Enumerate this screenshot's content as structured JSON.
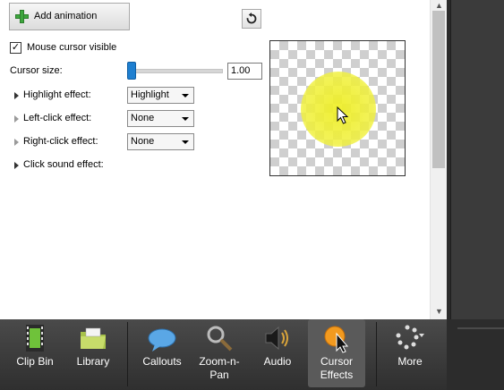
{
  "toolbar": {
    "add_animation_label": "Add animation"
  },
  "options": {
    "mouse_cursor_visible_label": "Mouse cursor visible",
    "mouse_cursor_visible_checked": true,
    "cursor_size_label": "Cursor size:",
    "cursor_size_value": "1.00",
    "highlight_effect_label": "Highlight effect:",
    "highlight_effect_value": "Highlight",
    "left_click_effect_label": "Left-click effect:",
    "left_click_effect_value": "None",
    "right_click_effect_label": "Right-click effect:",
    "right_click_effect_value": "None",
    "click_sound_effect_label": "Click sound effect:"
  },
  "tabs": [
    {
      "line1": "Clip Bin",
      "line2": "",
      "icon": "film-icon"
    },
    {
      "line1": "Library",
      "line2": "",
      "icon": "folder-icon"
    },
    {
      "line1": "Callouts",
      "line2": "",
      "icon": "speech-bubble-icon"
    },
    {
      "line1": "Zoom-n-",
      "line2": "Pan",
      "icon": "magnifier-icon"
    },
    {
      "line1": "Audio",
      "line2": "",
      "icon": "speaker-icon"
    },
    {
      "line1": "Cursor",
      "line2": "Effects",
      "icon": "cursor-effects-icon",
      "active": true
    },
    {
      "line1": "More",
      "line2": "",
      "icon": "more-dots-icon"
    }
  ],
  "colors": {
    "highlight_yellow": "#eeee28",
    "active_tab": "#5a5a5a",
    "slider_blue": "#1e7fd0"
  }
}
